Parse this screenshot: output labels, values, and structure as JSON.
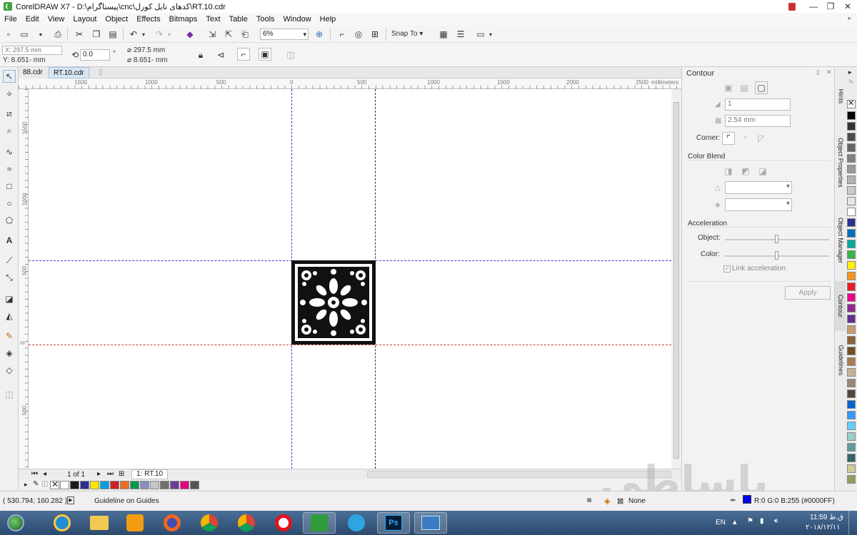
{
  "window": {
    "title": "CorelDRAW X7 - D:\\پیستاگرام\\cnc\\کدهای تایل کورل\\RT.10.cdr",
    "min": "—",
    "max": "❐",
    "close": "✕"
  },
  "menu": [
    "File",
    "Edit",
    "View",
    "Layout",
    "Object",
    "Effects",
    "Bitmaps",
    "Text",
    "Table",
    "Tools",
    "Window",
    "Help"
  ],
  "toolbar": {
    "zoom": "6%",
    "snap_to": "Snap To"
  },
  "propbar": {
    "x": "X: 297.5 mm",
    "y": "Y: 8.651- mm",
    "angle": "0.0",
    "deg": "°",
    "w": "297.5 mm",
    "h": "8.651- mm"
  },
  "doc_tabs": [
    "88.cdr",
    "RT.10.cdr"
  ],
  "ruler": {
    "top_labels": [
      "1500",
      "1000",
      "500",
      "0",
      "500",
      "1000",
      "1500",
      "2000",
      "2500"
    ],
    "unit": "millimeters",
    "left_labels": [
      "1500",
      "1000",
      "500",
      "0",
      "500"
    ]
  },
  "pager": {
    "count": "1 of 1",
    "page_tab": "1: RT.10"
  },
  "docker": {
    "title": "Contour",
    "steps": "1",
    "offset": "2.54 mm",
    "corner_label": "Corner:",
    "color_blend": "Color Blend",
    "acceleration": "Acceleration",
    "object_label": "Object:",
    "color_label": "Color:",
    "link_accel": "Link acceleration",
    "apply": "Apply"
  },
  "side_tabs": [
    "Hints",
    "Object Properties",
    "Object Manager",
    "Contour",
    "Guidelines"
  ],
  "status": {
    "coords": "( 530.794; 160.282 )",
    "message": "Guideline on Guides",
    "fill": "None",
    "outline": "R:0 G:0 B:255 (#0000FF)"
  },
  "colors": {
    "accent": "#0000FF",
    "palette": [
      "#1a1a1a",
      "#2e2f8f",
      "#ffe600",
      "#00a0e0",
      "#cf2027",
      "#e86f21",
      "#00984a",
      "#8b8cc3",
      "#c6c6c6",
      "#6e6e6e",
      "#6a3c95",
      "#e6007e",
      "#555555"
    ],
    "right_palette": [
      "#000000",
      "#333333",
      "#4d4d4d",
      "#666666",
      "#808080",
      "#999999",
      "#b3b3b3",
      "#cccccc",
      "#e6e6e6",
      "#ffffff",
      "#2e3192",
      "#0071bc",
      "#00a99d",
      "#39b54a",
      "#fff200",
      "#f7941d",
      "#ed1c24",
      "#ec008c",
      "#92278f",
      "#662d91",
      "#c69c6d",
      "#8c6239",
      "#754c24",
      "#a67c52",
      "#c7b299",
      "#998675",
      "#534741",
      "#0066cc",
      "#3399ff",
      "#66ccff",
      "#99cccc",
      "#669999",
      "#336666",
      "#cccc99",
      "#999966"
    ]
  },
  "taskbar": {
    "lang": "EN",
    "time": "11:59 ق.ظ",
    "date": "۲۰۱۸/۱۲/۱۱"
  },
  "watermark": "باساطی"
}
